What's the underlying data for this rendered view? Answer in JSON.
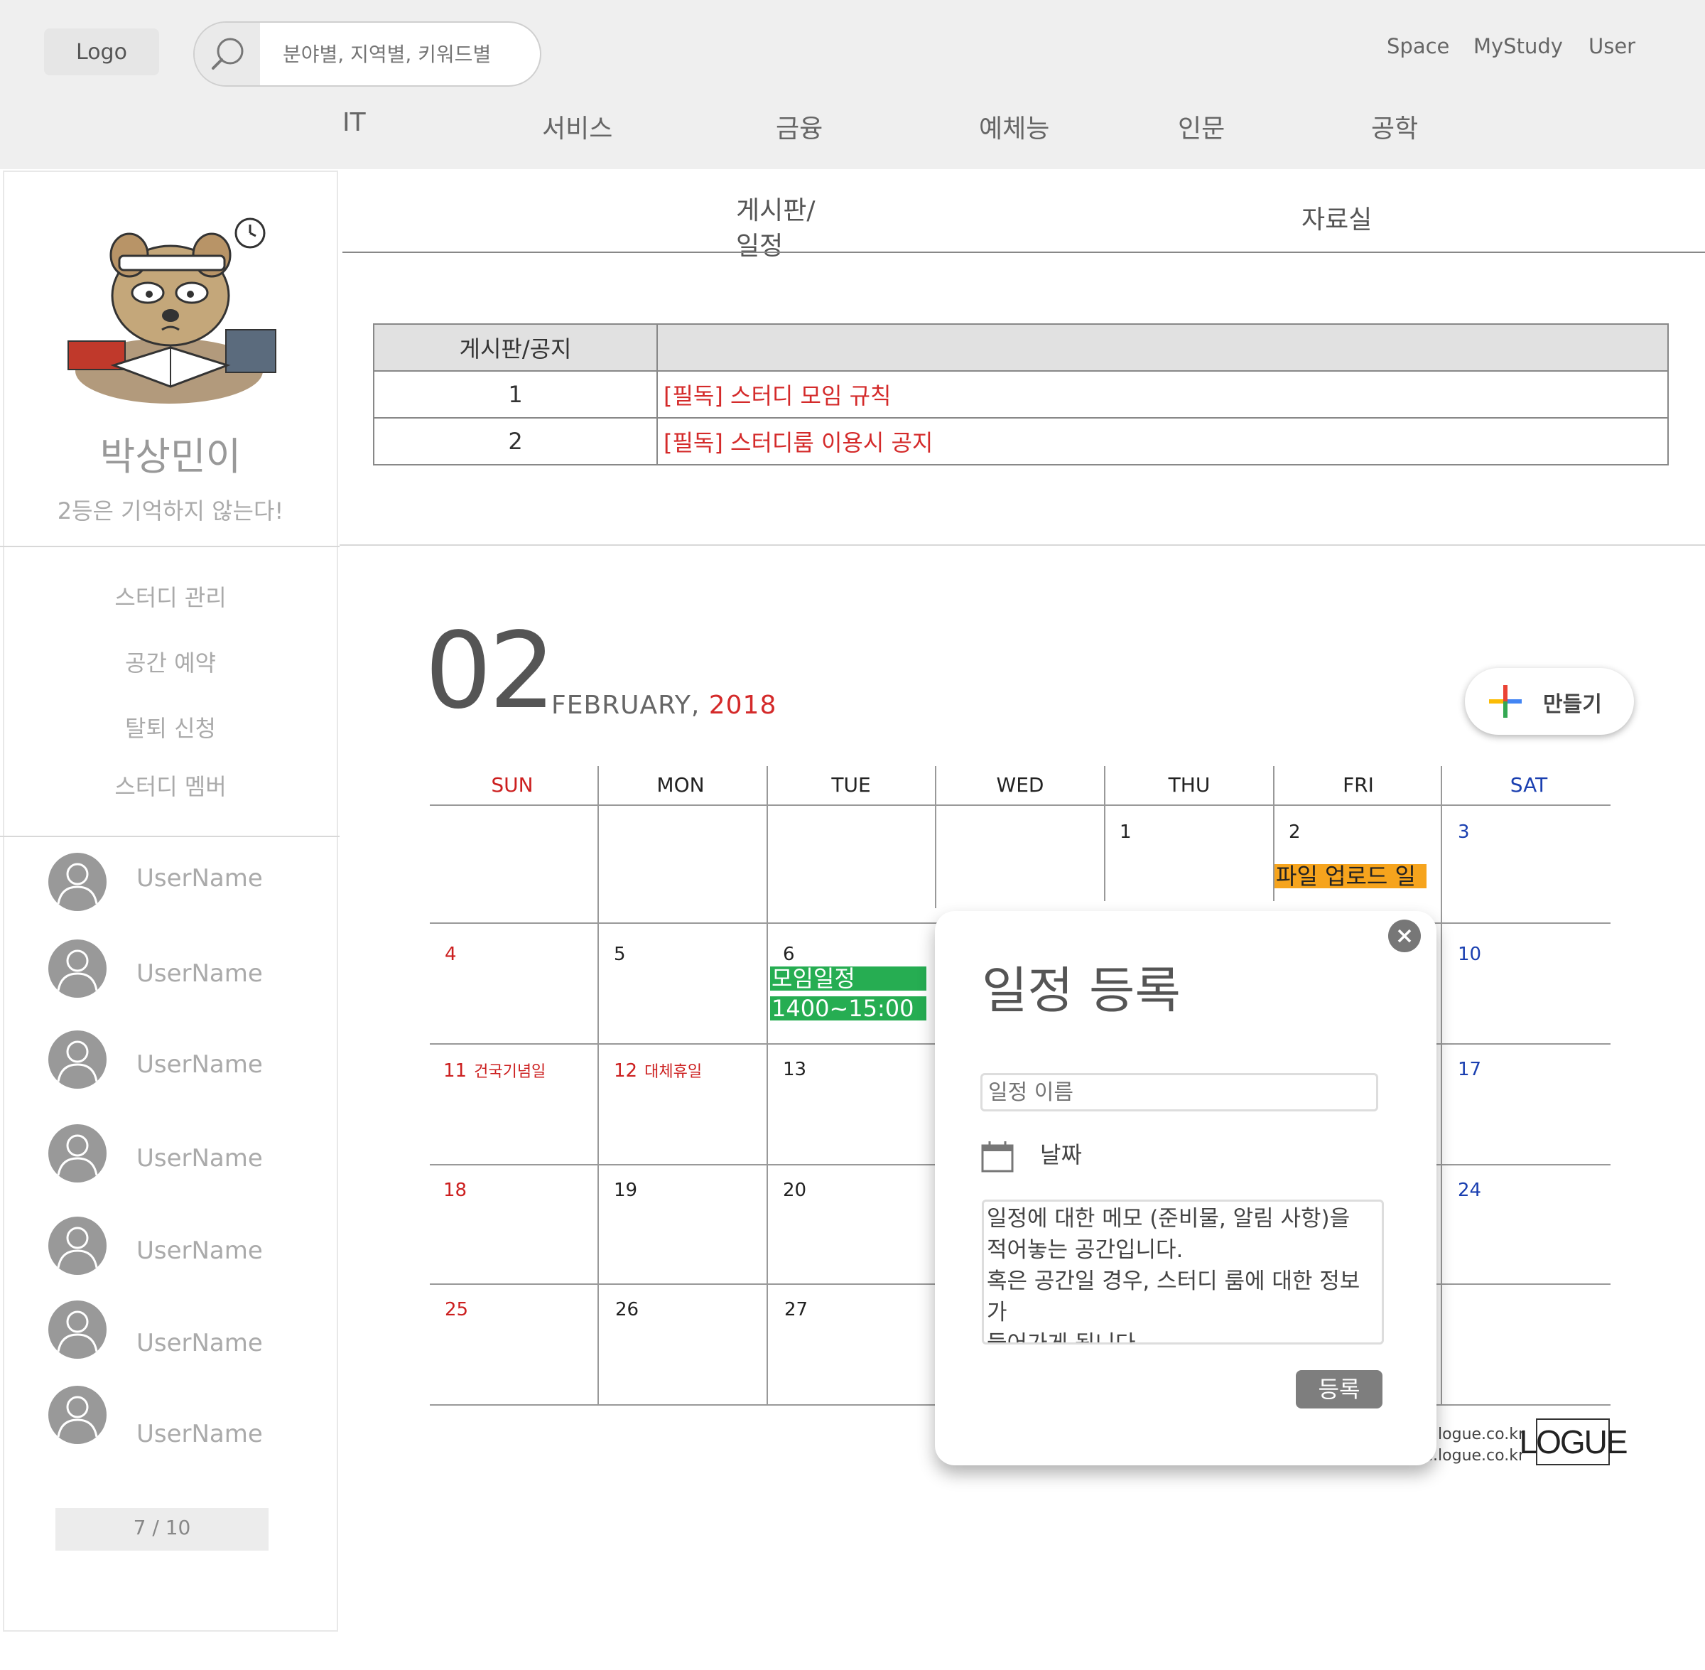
{
  "header": {
    "logo": "Logo",
    "search_placeholder": "분야별, 지역별, 키워드별",
    "links": [
      "Space",
      "MyStudy",
      "User"
    ],
    "categories": [
      "IT",
      "서비스",
      "금융",
      "예체능",
      "인문",
      "공학"
    ]
  },
  "profile": {
    "name": "박상민이",
    "motto": "2등은 기억하지 않는다!"
  },
  "side_menu": [
    "스터디 관리",
    "공간 예약",
    "탈퇴 신청",
    "스터디 멤버"
  ],
  "members": [
    "UserName",
    "UserName",
    "UserName",
    "UserName",
    "UserName",
    "UserName",
    "UserName"
  ],
  "pager": "7 / 10",
  "tabs": [
    "게시판/일정",
    "자료실"
  ],
  "notice": {
    "header": "게시판/공지",
    "rows": [
      {
        "num": "1",
        "title": "[필독] 스터디 모임 규칙"
      },
      {
        "num": "2",
        "title": "[필독] 스터디룸 이용시 공지"
      }
    ]
  },
  "calendar": {
    "month_number": "02",
    "month_name": "FEBRUARY, ",
    "year": "2018",
    "create_button": "만들기",
    "weekdays": [
      "SUN",
      "MON",
      "TUE",
      "WED",
      "THU",
      "FRI",
      "SAT"
    ],
    "days": {
      "d1": "1",
      "d2": "2",
      "d3": "3",
      "d4": "4",
      "d5": "5",
      "d6": "6",
      "d10": "10",
      "d11": "11",
      "d12": "12",
      "d13": "13",
      "d17": "17",
      "d18": "18",
      "d19": "19",
      "d20": "20",
      "d24": "24",
      "d25": "25",
      "d26": "26",
      "d27": "27"
    },
    "holidays": {
      "d11": "건국기념일",
      "d12": "대체휴일"
    },
    "events": {
      "file_upload": "파일 업로드 일",
      "meeting": "모임일정",
      "meeting_time": "1400~15:00"
    },
    "colors": {
      "sunday": "#cc1f1f",
      "saturday": "#1a3fb0",
      "meeting": "#26ad52",
      "upload": "#f6a41d"
    }
  },
  "modal": {
    "title": "일정 등록",
    "name_placeholder": "일정 이름",
    "date_label": "날짜",
    "memo": "일정에 대한 메모 (준비물, 알림 사항)을\n적어놓는 공간입니다.\n혹은 공간일 경우, 스터디 룸에 대한 정보가\n들어가게 됩니다.",
    "register_button": "등록"
  },
  "footer": {
    "url1": ".logue.co.kr",
    "url2": "e.logue.co.kr",
    "brand": "LOGUE"
  }
}
